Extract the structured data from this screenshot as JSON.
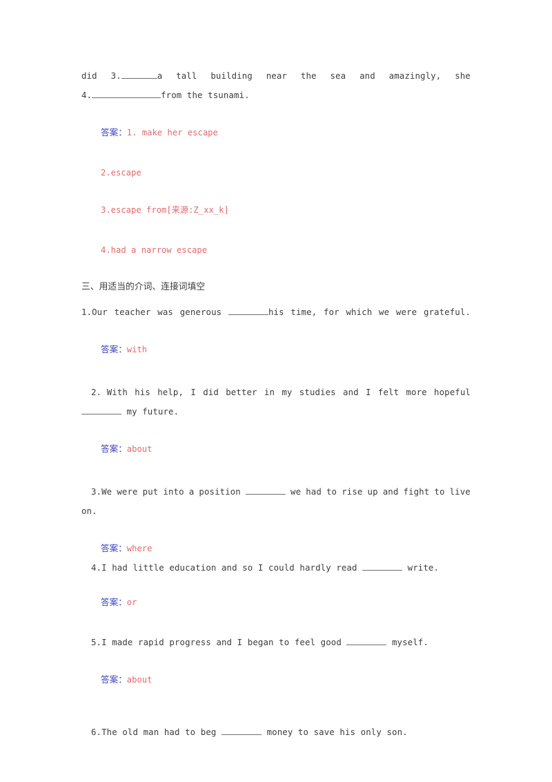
{
  "document": {
    "type": "english-exercise-worksheet",
    "answer_label": "答案：",
    "colors": {
      "body_text": "#3d3d3d",
      "answer_label": "#3f3fc0",
      "answer_text": "#e2696b",
      "rule": "#6f6f6f",
      "background": "#ffffff"
    }
  },
  "top_passage": {
    "line1_pre": "did",
    "line1_num": "3.",
    "line1_post": "a tall building near the sea and amazingly, she",
    "line1_words": [
      "did",
      "3.",
      "a",
      "tall",
      "building",
      "near",
      "the",
      "sea",
      "and",
      "amazingly,",
      "she"
    ],
    "line2_num": "4.",
    "line2_post": "from the tsunami."
  },
  "top_answers": {
    "label": "答案：",
    "items": [
      "1. make her escape",
      "2.escape",
      "3.escape from[来源:Z_xx_k]",
      "4.had a narrow escape"
    ]
  },
  "section": {
    "heading": "三、用适当的介词、连接词填空",
    "questions": [
      {
        "number": "1.",
        "text_before": "Our teacher was generous ",
        "text_after": "his time, for which we were grateful.",
        "blank_size": "w-md",
        "answer_label": "答案：",
        "answer": "with"
      },
      {
        "number": "2. ",
        "text_before": "With his help, I did better in my studies and I felt more hopeful",
        "text_after": " my future.",
        "blank_size": "w-md",
        "answer_label": "答案：",
        "answer": "about"
      },
      {
        "number": "3.",
        "text_before": "We were put into a position ",
        "text_after": " we had to rise up and fight to live on.",
        "blank_size": "w-md",
        "answer_label": "答案：",
        "answer": "where"
      },
      {
        "number": "4.",
        "text_before": "I had little education and so I could hardly read ",
        "text_after": " write.",
        "blank_size": "w-md",
        "answer_label": "答案：",
        "answer": "or"
      },
      {
        "number": "5.",
        "text_before": "I made rapid progress and I began to feel good ",
        "text_after": " myself.",
        "blank_size": "w-md",
        "answer_label": "答案：",
        "answer": "about"
      },
      {
        "number": "6.",
        "text_before": "The old man had to beg ",
        "text_after": " money to save his only son.",
        "blank_size": "w-md",
        "answer_label": "",
        "answer": ""
      }
    ]
  }
}
